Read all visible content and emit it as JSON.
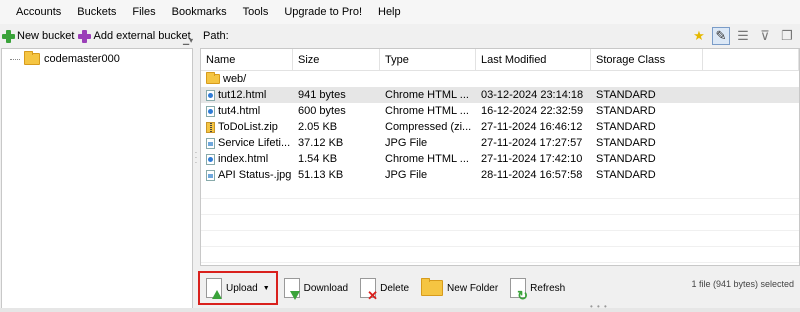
{
  "menu": [
    "Accounts",
    "Buckets",
    "Files",
    "Bookmarks",
    "Tools",
    "Upgrade to Pro!",
    "Help"
  ],
  "left_toolbar": {
    "new_bucket": "New bucket",
    "add_external_bucket": "Add external bucket"
  },
  "path_label": "Path:",
  "tree": {
    "root": "codemaster000"
  },
  "columns": [
    "Name",
    "Size",
    "Type",
    "Last Modified",
    "Storage Class"
  ],
  "folder_row": {
    "name": "web/"
  },
  "files": [
    {
      "name": "tut12.html",
      "size": "941 bytes",
      "type": "Chrome HTML ...",
      "modified": "03-12-2024 23:14:18",
      "storage": "STANDARD",
      "icon": "html-file-icon"
    },
    {
      "name": "tut4.html",
      "size": "600 bytes",
      "type": "Chrome HTML ...",
      "modified": "16-12-2024 22:32:59",
      "storage": "STANDARD",
      "icon": "html-file-icon"
    },
    {
      "name": "ToDoList.zip",
      "size": "2.05 KB",
      "type": "Compressed (zi...",
      "modified": "27-11-2024 16:46:12",
      "storage": "STANDARD",
      "icon": "zip-file-icon"
    },
    {
      "name": "Service Lifeti...",
      "size": "37.12 KB",
      "type": "JPG File",
      "modified": "27-11-2024 17:27:57",
      "storage": "STANDARD",
      "icon": "image-file-icon"
    },
    {
      "name": "index.html",
      "size": "1.54 KB",
      "type": "Chrome HTML ...",
      "modified": "27-11-2024 17:42:10",
      "storage": "STANDARD",
      "icon": "html-file-icon"
    },
    {
      "name": "API Status-.jpg",
      "size": "51.13 KB",
      "type": "JPG File",
      "modified": "28-11-2024 16:57:58",
      "storage": "STANDARD",
      "icon": "image-file-icon"
    }
  ],
  "actions": {
    "upload": "Upload",
    "download": "Download",
    "delete": "Delete",
    "new_folder": "New Folder",
    "refresh": "Refresh"
  },
  "status": "1 file (941 bytes) selected",
  "colors": {
    "highlight_border": "#d9201c",
    "selected_row": "#e6e6e6",
    "folder": "#f5c542",
    "accent_green": "#3aa33a"
  }
}
